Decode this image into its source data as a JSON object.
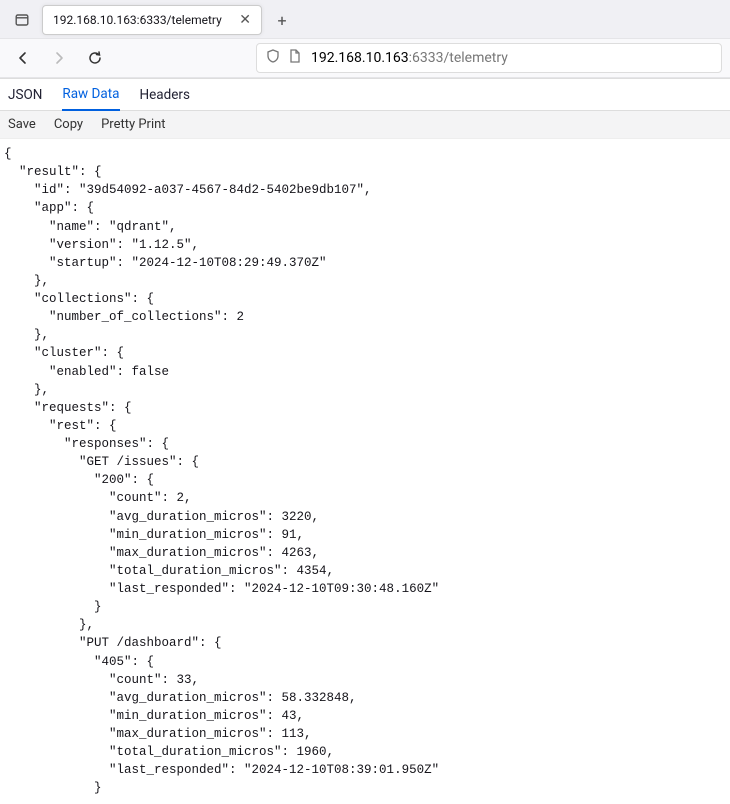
{
  "tab": {
    "title": "192.168.10.163:6333/telemetry"
  },
  "url": {
    "host": "192.168.10.163",
    "port_path": ":6333/telemetry"
  },
  "viewer_tabs": {
    "json": "JSON",
    "raw": "Raw Data",
    "headers": "Headers"
  },
  "actions": {
    "save": "Save",
    "copy": "Copy",
    "pretty": "Pretty Print"
  },
  "json_lines": [
    "{",
    "  \"result\": {",
    "    \"id\": \"39d54092-a037-4567-84d2-5402be9db107\",",
    "    \"app\": {",
    "      \"name\": \"qdrant\",",
    "      \"version\": \"1.12.5\",",
    "      \"startup\": \"2024-12-10T08:29:49.370Z\"",
    "    },",
    "    \"collections\": {",
    "      \"number_of_collections\": 2",
    "    },",
    "    \"cluster\": {",
    "      \"enabled\": false",
    "    },",
    "    \"requests\": {",
    "      \"rest\": {",
    "        \"responses\": {",
    "          \"GET /issues\": {",
    "            \"200\": {",
    "              \"count\": 2,",
    "              \"avg_duration_micros\": 3220,",
    "              \"min_duration_micros\": 91,",
    "              \"max_duration_micros\": 4263,",
    "              \"total_duration_micros\": 4354,",
    "              \"last_responded\": \"2024-12-10T09:30:48.160Z\"",
    "            }",
    "          },",
    "          \"PUT /dashboard\": {",
    "            \"405\": {",
    "              \"count\": 33,",
    "              \"avg_duration_micros\": 58.332848,",
    "              \"min_duration_micros\": 43,",
    "              \"max_duration_micros\": 113,",
    "              \"total_duration_micros\": 1960,",
    "              \"last_responded\": \"2024-12-10T08:39:01.950Z\"",
    "            }"
  ]
}
